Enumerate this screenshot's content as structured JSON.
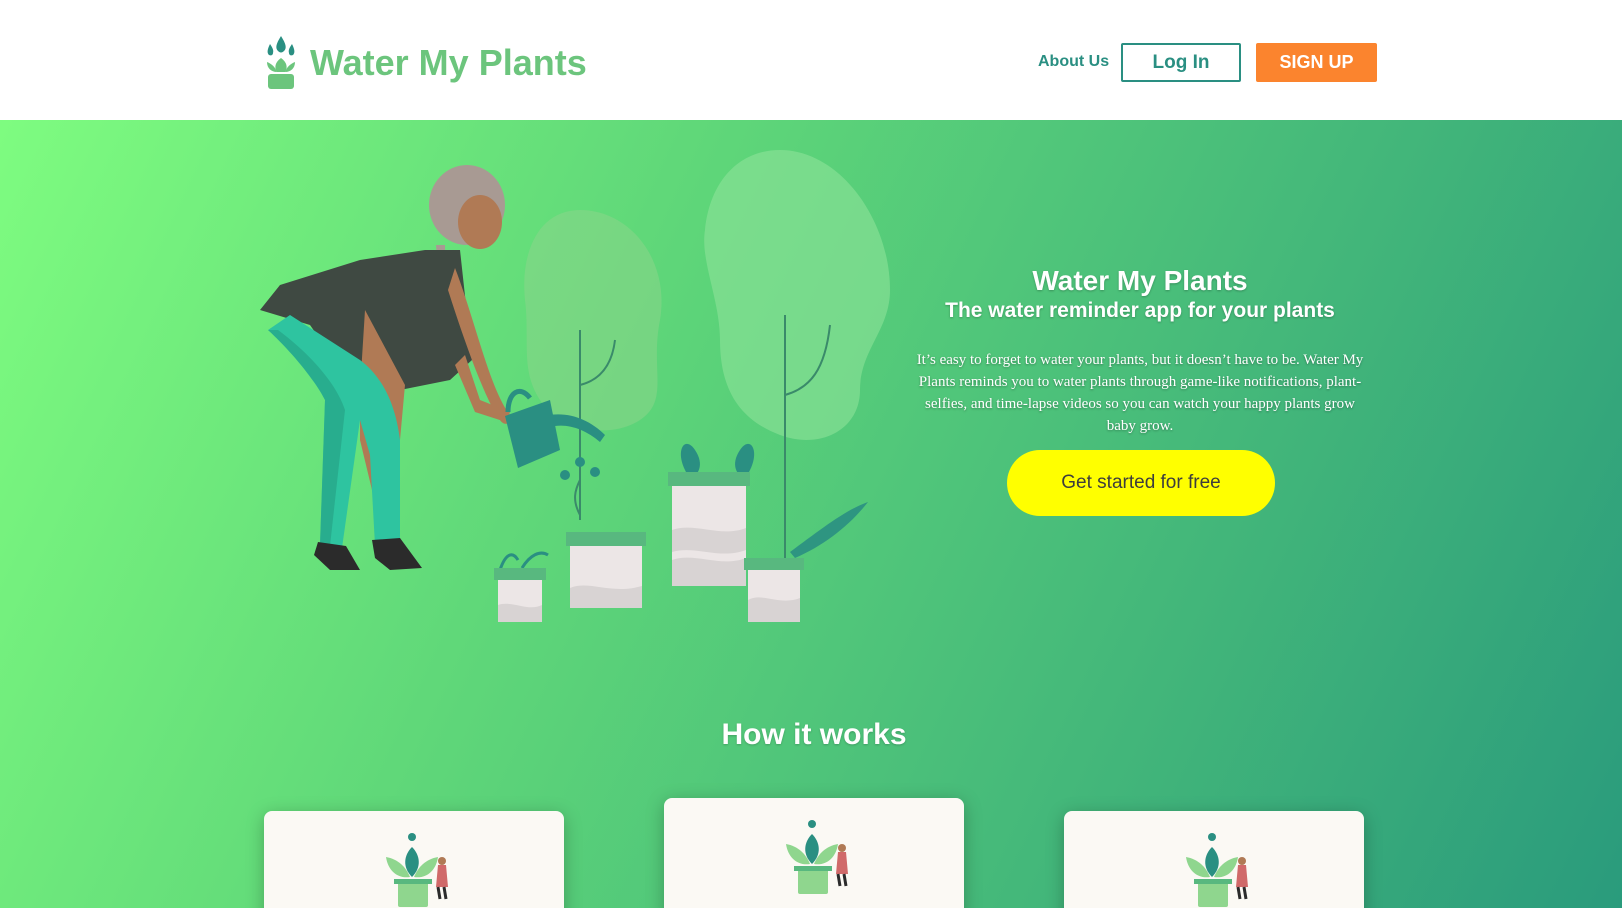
{
  "header": {
    "brand_name": "Water My Plants",
    "nav": {
      "about_label": "About Us",
      "login_label": "Log In",
      "signup_label": "SIGN UP"
    }
  },
  "hero": {
    "title": "Water My Plants",
    "subtitle": "The water reminder app for your plants",
    "description": "It’s easy to forget to water your plants, but it doesn’t have to be. Water My Plants reminds you to water plants through game-like notifications, plant-selfies, and time-lapse videos so you can watch your happy plants grow baby grow.",
    "cta_label": "Get started for free"
  },
  "how_it_works": {
    "title": "How it works",
    "cards": [
      {
        "icon": "plant-illustration-icon",
        "caption": ""
      },
      {
        "icon": "plant-illustration-icon",
        "caption": ""
      },
      {
        "icon": "plant-illustration-icon",
        "caption": ""
      }
    ]
  },
  "colors": {
    "brand_green": "#6cc57d",
    "accent_teal": "#2a8f82",
    "signup_orange": "#fb842e",
    "cta_yellow": "#ffff00",
    "gradient_start": "#7efc80",
    "gradient_end": "#2a9b7c"
  }
}
